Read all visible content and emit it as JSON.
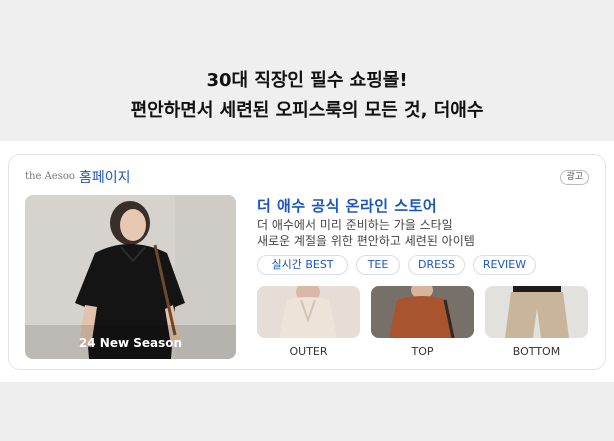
{
  "headline": {
    "line1": "30대 직장인 필수 쇼핑몰!",
    "line2": "편안하면서 세련된 오피스룩의 모든 것, 더애수"
  },
  "ad": {
    "site_logo": "the Aesoo",
    "site_link": "홈페이지",
    "badge": "광고",
    "hero_caption": "24 New Season",
    "title": "더 애수 공식 온라인 스토어",
    "description_1": "더 애수에서 미리 준비하는 가을 스타일",
    "description_2": "새로운 계절을 위한 편안하고 세련된 아이템",
    "chips": [
      "실시간 BEST",
      "TEE",
      "DRESS",
      "REVIEW"
    ],
    "thumbnails": [
      {
        "label": "OUTER",
        "color": "#e9ddd2"
      },
      {
        "label": "TOP",
        "color": "#a9532f"
      },
      {
        "label": "BOTTOM",
        "color": "#c9b59a"
      }
    ]
  },
  "colors": {
    "link_blue": "#1a55c4",
    "page_bg": "#eeeeee",
    "card_bg": "#ffffff"
  }
}
